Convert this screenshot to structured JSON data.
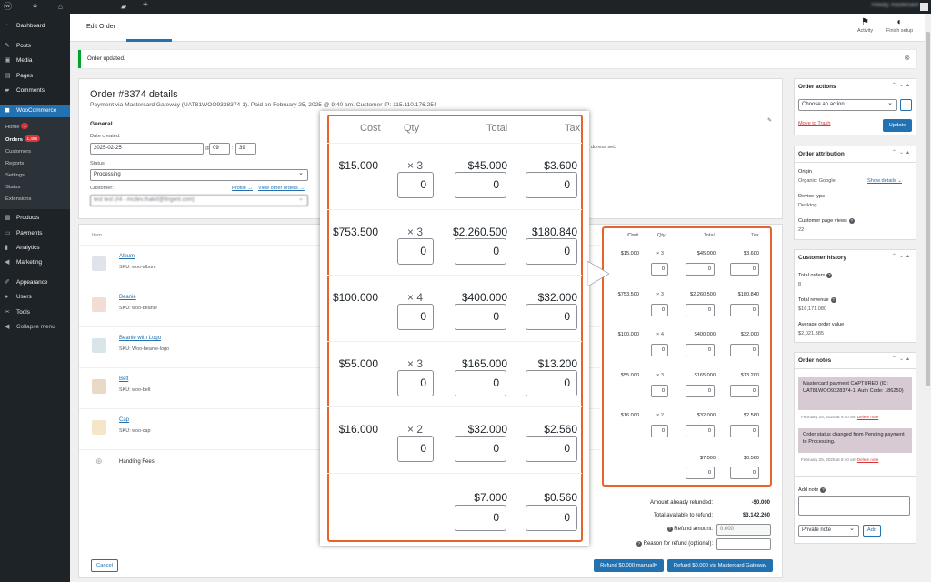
{
  "admin_bar": {
    "howdy": "Howdy, mastercard"
  },
  "sidebar": {
    "items": [
      {
        "label": "Dashboard",
        "icon": "dashboard-icon"
      },
      {
        "label": "Posts",
        "icon": "pushpin-icon"
      },
      {
        "label": "Media",
        "icon": "media-icon"
      },
      {
        "label": "Pages",
        "icon": "pages-icon"
      },
      {
        "label": "Comments",
        "icon": "comment-icon"
      },
      {
        "label": "WooCommerce",
        "icon": "woo-icon"
      },
      {
        "label": "Products",
        "icon": "box-icon"
      },
      {
        "label": "Payments",
        "icon": "card-icon"
      },
      {
        "label": "Analytics",
        "icon": "bar-chart-icon"
      },
      {
        "label": "Marketing",
        "icon": "megaphone-icon"
      },
      {
        "label": "Appearance",
        "icon": "brush-icon"
      },
      {
        "label": "Users",
        "icon": "user-icon"
      },
      {
        "label": "Tools",
        "icon": "wrench-icon"
      },
      {
        "label": "Collapse menu",
        "icon": "collapse-icon"
      }
    ],
    "woo_sub": [
      {
        "label": "Home",
        "badge": "1"
      },
      {
        "label": "Orders",
        "badge": "1,496"
      },
      {
        "label": "Customers"
      },
      {
        "label": "Reports"
      },
      {
        "label": "Settings"
      },
      {
        "label": "Status"
      },
      {
        "label": "Extensions"
      }
    ]
  },
  "topbar": {
    "title": "Edit Order",
    "activity": "Activity",
    "finish_setup": "Finish setup"
  },
  "notice": {
    "text": "Order updated."
  },
  "order": {
    "title": "Order #8374 details",
    "subtitle": "Payment via Mastercard Gateway (UAT81WOO9328374-1). Paid on February 25, 2025 @ 9:40 am. Customer IP: 115.110.176.254",
    "general": "General",
    "date_created_label": "Date created:",
    "date": "2025-02-25",
    "hour": "09",
    "minute": "39",
    "at": "@",
    "colon": ":",
    "status_label": "Status:",
    "status": "Processing",
    "customer_label": "Customer:",
    "profile_link": "Profile →",
    "other_orders_link": "View other orders →",
    "customer_value": "test test (#4 - mcdev.thakkf@fingent.com)",
    "address_fragment": "ddress set."
  },
  "items": {
    "header_item": "Item",
    "header_cost": "Cost",
    "header_qty": "Qty",
    "header_total": "Total",
    "header_tax": "Tax",
    "rows": [
      {
        "name": "Album",
        "sku": "SKU: woo-album",
        "cost": "$15.000",
        "qty": "× 3",
        "total": "$45.000",
        "tax": "$3.600",
        "refund_qty": "0",
        "refund_total": "0",
        "refund_tax": "0"
      },
      {
        "name": "Beanie",
        "sku": "SKU: woo-beanie",
        "cost": "$753.500",
        "qty": "× 3",
        "total": "$2,260.500",
        "tax": "$180.840",
        "refund_qty": "0",
        "refund_total": "0",
        "refund_tax": "0"
      },
      {
        "name": "Beanie with Logo",
        "sku": "SKU: Woo-beanie-logo",
        "cost": "$100.000",
        "qty": "× 4",
        "total": "$400.000",
        "tax": "$32.000",
        "refund_qty": "0",
        "refund_total": "0",
        "refund_tax": "0"
      },
      {
        "name": "Belt",
        "sku": "SKU: woo-belt",
        "cost": "$55.000",
        "qty": "× 3",
        "total": "$165.000",
        "tax": "$13.200",
        "refund_qty": "0",
        "refund_total": "0",
        "refund_tax": "0"
      },
      {
        "name": "Cap",
        "sku": "SKU: woo-cap",
        "cost": "$16.000",
        "qty": "× 2",
        "total": "$32.000",
        "tax": "$2.560",
        "refund_qty": "0",
        "refund_total": "0",
        "refund_tax": "0"
      }
    ],
    "fee": {
      "name": "Handling Fees",
      "total": "$7.000",
      "tax": "$0.560",
      "refund_total": "0",
      "refund_tax": "0"
    }
  },
  "refund": {
    "already_label": "Amount already refunded:",
    "already_value": "-$0.000",
    "available_label": "Total available to refund:",
    "available_value": "$3,142.260",
    "amount_label": "Refund amount:",
    "amount_value": "0.000",
    "reason_label": "Reason for refund (optional):",
    "cancel": "Cancel",
    "manual_btn": "Refund $0.000 manually",
    "gateway_btn": "Refund $0.000 via Mastercard Gateway"
  },
  "order_actions": {
    "title": "Order actions",
    "select": "Choose an action...",
    "trash": "Move to Trash",
    "update": "Update"
  },
  "attribution": {
    "title": "Order attribution",
    "origin_label": "Origin",
    "origin_value": "Organic: Google",
    "show_details": "Show details",
    "device_label": "Device type",
    "device_value": "Desktop",
    "views_label": "Customer page views",
    "views_value": "22"
  },
  "history": {
    "title": "Customer history",
    "orders_label": "Total orders",
    "orders_value": "8",
    "revenue_label": "Total revenue",
    "revenue_value": "$16,171.080",
    "aov_label": "Average order value",
    "aov_value": "$2,021.385"
  },
  "notes": {
    "title": "Order notes",
    "items": [
      {
        "text": "Mastercard payment CAPTURED (ID: UAT81WOO9328374-1, Auth Code: 186250)",
        "meta": "February 25, 2025 at 9:40 am",
        "delete": "Delete note"
      },
      {
        "text": "Order status changed from Pending payment to Processing.",
        "meta": "February 25, 2025 at 9:40 am",
        "delete": "Delete note"
      }
    ],
    "add_label": "Add note",
    "type": "Private note",
    "add_btn": "Add"
  },
  "colors": {
    "accent": "#2271b1",
    "highlight": "#e8622b",
    "note_bg": "#d7cad2",
    "sidebar": "#1d2327"
  }
}
